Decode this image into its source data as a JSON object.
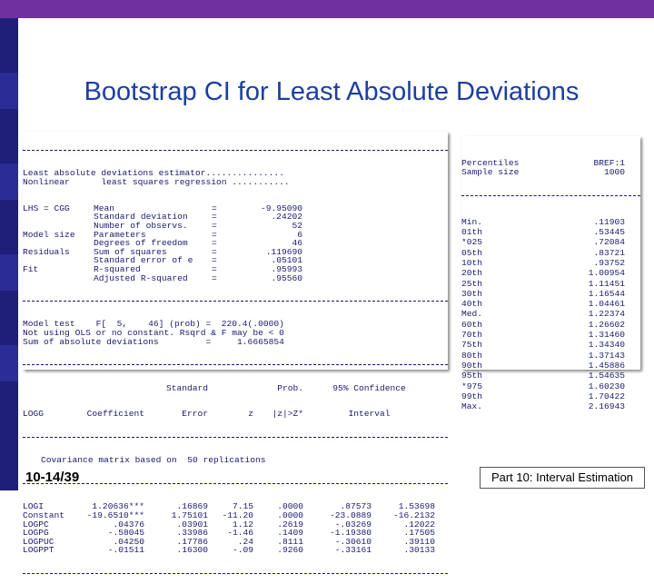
{
  "slide": {
    "title": "Bootstrap CI for Least Absolute Deviations",
    "footer_left": "10-14/39",
    "footer_right": "Part 10: Interval Estimation"
  },
  "left_output": {
    "header_lines": [
      "Least absolute deviations estimator...............",
      "Nonlinear      least squares regression ..........."
    ],
    "stats": [
      [
        "LHS = CGG",
        "Mean",
        "=",
        "-9.95090"
      ],
      [
        "",
        "Standard deviation",
        "=",
        ".24202"
      ],
      [
        "",
        "Number of observs.",
        "=",
        "52"
      ],
      [
        "Model size",
        "Parameters",
        "=",
        "6"
      ],
      [
        "",
        "Degrees of freedom",
        "=",
        "46"
      ],
      [
        "Residuals",
        "Sum of squares",
        "=",
        ".119690"
      ],
      [
        "",
        "Standard error of e",
        "=",
        ".05101"
      ],
      [
        "Fit",
        "R-squared",
        "=",
        ".95993"
      ],
      [
        "",
        "Adjusted R-squared",
        "=",
        ".95560"
      ]
    ],
    "footer_lines": [
      "Model test    F[  5,    46] (prob) =  220.4(.0000)",
      "Not using OLS or no constant. Rsqrd & F may be < 0",
      "Sum of absolute deviations         =     1.6665854"
    ],
    "table_header1": [
      "",
      "",
      "Standard",
      "",
      "Prob.",
      "95% Confidence"
    ],
    "table_header2": [
      "LOGG",
      "Coefficient",
      "Error",
      "z",
      "|z|>Z*",
      "Interval"
    ],
    "cov_note": "Covariance matrix based on  50 replications",
    "rows": [
      [
        "LOGI",
        "1.20636***",
        ".16869",
        "7.15",
        ".0000",
        ".87573",
        "1.53698"
      ],
      [
        "Constant",
        "-19.6510***",
        "1.75101",
        "-11.20",
        ".0000",
        "-23.0889",
        "-16.2132"
      ],
      [
        "LOGPC",
        ".04376",
        ".03901",
        "1.12",
        ".2619",
        "-.03269",
        ".12022"
      ],
      [
        "LOGPG",
        "-.58045",
        ".33986",
        "-1.46",
        ".1409",
        "-1.19380",
        ".17505"
      ],
      [
        "LOGPUC",
        ".04250",
        ".17786",
        ".24",
        ".8111",
        "-.30610",
        ".39110"
      ],
      [
        "LOGPPT",
        "-.01511",
        ".16300",
        "-.09",
        ".9260",
        "-.33161",
        ".30133"
      ]
    ]
  },
  "right_output": {
    "header": [
      [
        "Percentiles",
        "BREF:1"
      ],
      [
        "Sample size",
        "1000"
      ]
    ],
    "rows": [
      [
        "Min.",
        ".11903"
      ],
      [
        "01th",
        ".53445"
      ],
      [
        "*025",
        ".72084"
      ],
      [
        "05th",
        ".83721"
      ],
      [
        "10th",
        ".93752"
      ],
      [
        "20th",
        "1.00954"
      ],
      [
        "25th",
        "1.11451"
      ],
      [
        "30th",
        "1.16544"
      ],
      [
        "40th",
        "1.04461"
      ],
      [
        "Med.",
        "1.22374"
      ],
      [
        "60th",
        "1.26602"
      ],
      [
        "70th",
        "1.31460"
      ],
      [
        "75th",
        "1.34340"
      ],
      [
        "80th",
        "1.37143"
      ],
      [
        "90th",
        "1.45886"
      ],
      [
        "95th",
        "1.54635"
      ],
      [
        "*975",
        "1.60230"
      ],
      [
        "99th",
        "1.70422"
      ],
      [
        "Max.",
        "2.16943"
      ]
    ]
  },
  "colors": {
    "top_bar": "#7030a0",
    "left_bar": "#1f1f7a",
    "title": "#1c3fa0",
    "output_text": "#1a1a6e"
  }
}
